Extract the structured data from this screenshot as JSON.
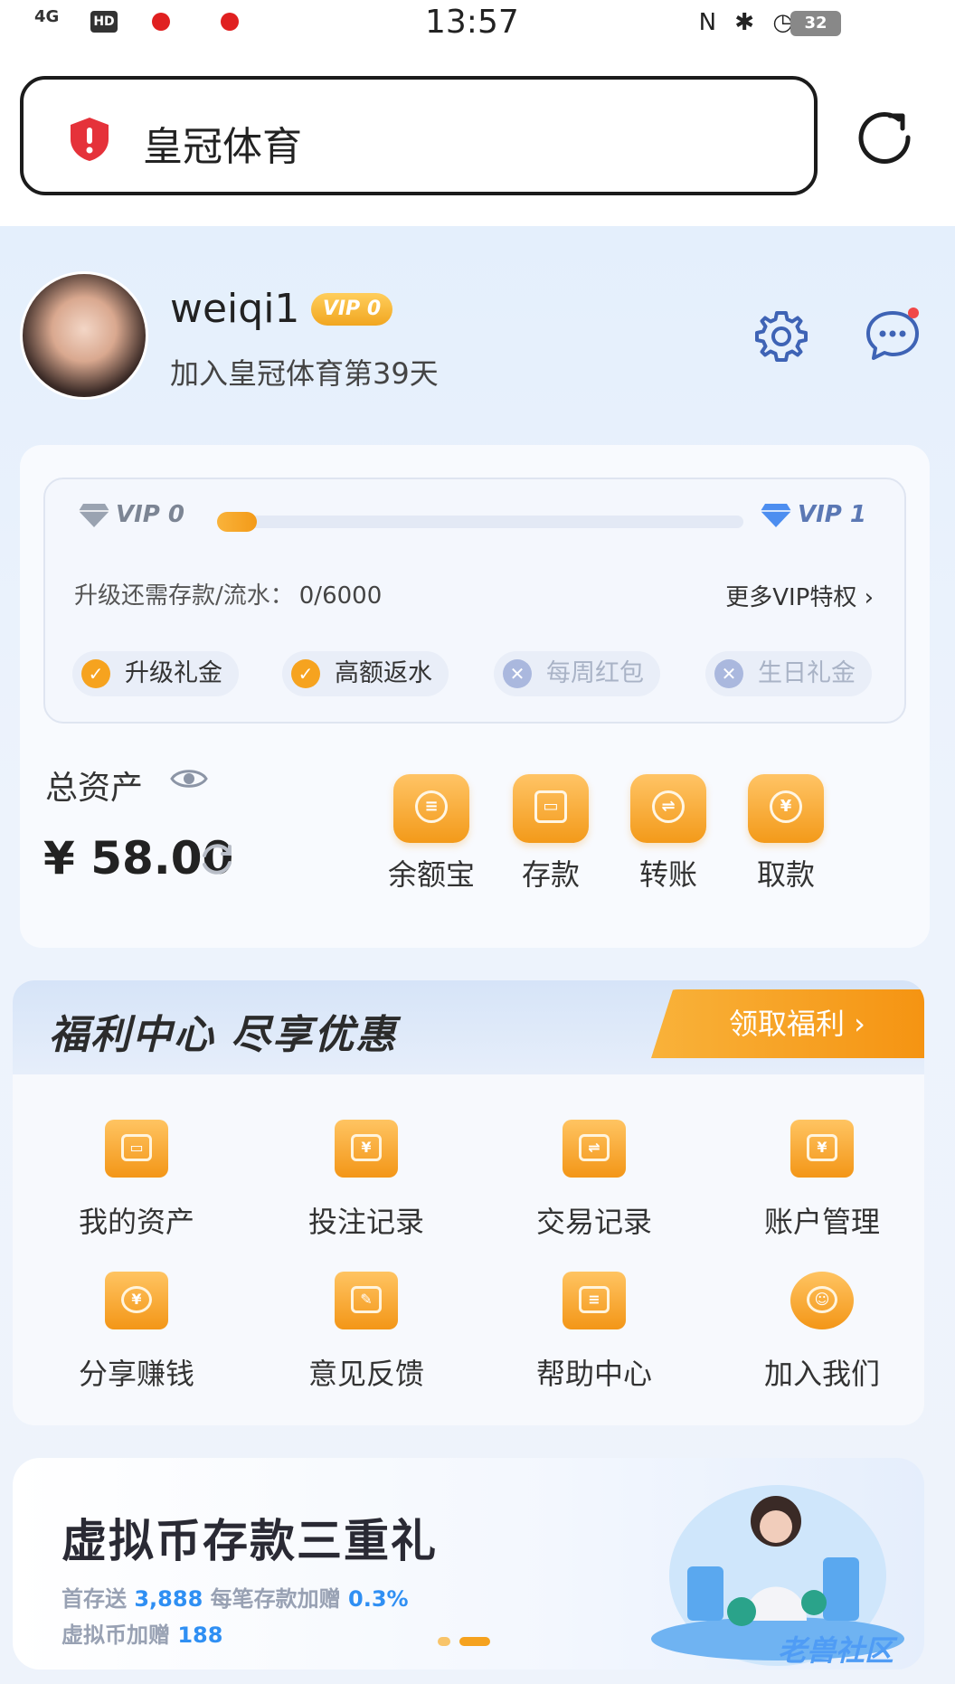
{
  "status_bar": {
    "network": "4G",
    "hd": "HD",
    "time": "13:57",
    "battery": "32"
  },
  "url_bar": {
    "title": "皇冠体育"
  },
  "profile": {
    "username": "weiqi1",
    "vip_badge": "VIP 0",
    "join_text": "加入皇冠体育第39天"
  },
  "vip": {
    "current_level": "VIP 0",
    "next_level": "VIP 1",
    "progress_fraction": 0.0,
    "upgrade_label": "升级还需存款/流水：",
    "upgrade_value": "0/6000",
    "more_label": "更多VIP特权 ›",
    "perks": [
      {
        "label": "升级礼金",
        "enabled": true
      },
      {
        "label": "高额返水",
        "enabled": true
      },
      {
        "label": "每周红包",
        "enabled": false
      },
      {
        "label": "生日礼金",
        "enabled": false
      }
    ]
  },
  "assets": {
    "label": "总资产",
    "amount": "¥ 58.00",
    "actions": [
      {
        "label": "余额宝",
        "icon": "coins-icon"
      },
      {
        "label": "存款",
        "icon": "wallet-icon"
      },
      {
        "label": "转账",
        "icon": "transfer-icon"
      },
      {
        "label": "取款",
        "icon": "withdraw-icon"
      }
    ]
  },
  "welfare": {
    "title": "福利中心  尽享优惠",
    "claim_label": "领取福利  ›",
    "items": [
      {
        "label": "我的资产",
        "icon": "wallet-icon"
      },
      {
        "label": "投注记录",
        "icon": "bet-record-icon"
      },
      {
        "label": "交易记录",
        "icon": "transaction-icon"
      },
      {
        "label": "账户管理",
        "icon": "account-folder-icon"
      },
      {
        "label": "分享赚钱",
        "icon": "share-money-icon"
      },
      {
        "label": "意见反馈",
        "icon": "feedback-icon"
      },
      {
        "label": "帮助中心",
        "icon": "help-icon"
      },
      {
        "label": "加入我们",
        "icon": "join-us-icon"
      }
    ]
  },
  "banner": {
    "title": "虚拟币存款三重礼",
    "line1_prefix": "首存送 ",
    "line1_value": "3,888",
    "line1_mid": "  每笔存款加赠 ",
    "line1_value2": "0.3%",
    "line2_prefix": "虚拟币加赠 ",
    "line2_value": "188",
    "watermark": "老兽社区"
  },
  "colors": {
    "accent": "#F5A21F",
    "highlight": "#2F8FF3",
    "background": "#EDF3FC"
  }
}
